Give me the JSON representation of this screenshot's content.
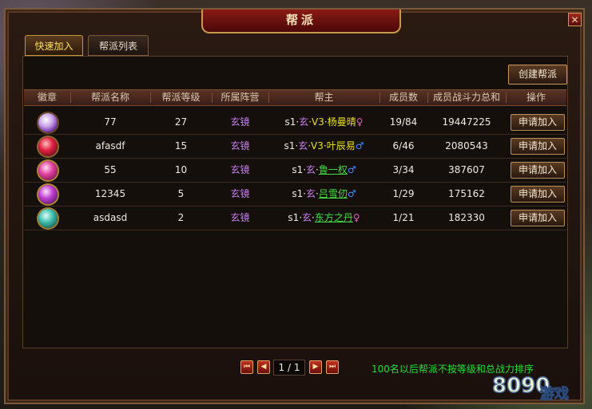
{
  "window": {
    "title": "帮派",
    "close_label": "✕"
  },
  "tabs": [
    {
      "label": "快速加入",
      "active": true
    },
    {
      "label": "帮派列表",
      "active": false
    }
  ],
  "create_button": "创建帮派",
  "table": {
    "headers": [
      "徽章",
      "帮派名称",
      "帮派等级",
      "所属阵营",
      "帮主",
      "成员数",
      "成员战斗力总和",
      "操作"
    ],
    "rows": [
      {
        "name": "77",
        "level": "27",
        "camp": "玄镜",
        "leader_prefix": "s1·",
        "leader_camp": "玄",
        "vip": "V3",
        "leader_name": "杨曼晴",
        "gender": "♀",
        "members": "19/84",
        "power": "19447225",
        "action": "申请加入"
      },
      {
        "name": "afasdf",
        "level": "15",
        "camp": "玄镜",
        "leader_prefix": "s1·",
        "leader_camp": "玄",
        "vip": "V3",
        "leader_name": "叶辰易",
        "gender": "♂",
        "members": "6/46",
        "power": "2080543",
        "action": "申请加入"
      },
      {
        "name": "55",
        "level": "10",
        "camp": "玄镜",
        "leader_prefix": "s1·",
        "leader_camp": "玄",
        "vip": "",
        "leader_name": "鲁一权",
        "gender": "♂",
        "members": "3/34",
        "power": "387607",
        "action": "申请加入"
      },
      {
        "name": "12345",
        "level": "5",
        "camp": "玄镜",
        "leader_prefix": "s1·",
        "leader_camp": "玄",
        "vip": "",
        "leader_name": "吕雪仞",
        "gender": "♂",
        "members": "1/29",
        "power": "175162",
        "action": "申请加入"
      },
      {
        "name": "asdasd",
        "level": "2",
        "camp": "玄镜",
        "leader_prefix": "s1·",
        "leader_camp": "玄",
        "vip": "",
        "leader_name": "东方之丹",
        "gender": "♀",
        "members": "1/21",
        "power": "182330",
        "action": "申请加入"
      }
    ],
    "badge_icons": [
      "white-purple-gem-icon",
      "red-gem-icon",
      "pink-gem-icon",
      "magenta-gem-icon",
      "teal-gem-icon"
    ]
  },
  "pagination": {
    "page_info": "1 / 1"
  },
  "note": "100名以后帮派不按等级和总战力排序",
  "watermark": "8090 游戏",
  "colors": {
    "camp": "#c880f0",
    "vip": "#e8e020",
    "name_link": "#40e040",
    "note": "#20e030",
    "title_bg": "#8a1a14"
  }
}
